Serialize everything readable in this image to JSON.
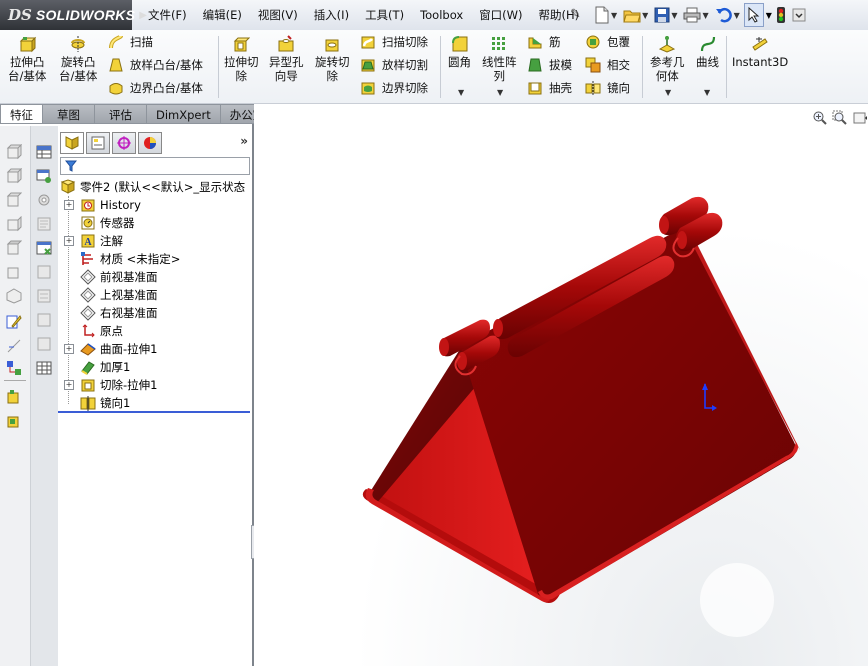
{
  "app": {
    "brand_symbol": "DS",
    "brand_name": "SOLIDWORKS",
    "brand_arrow": "▶"
  },
  "menu": [
    "文件(F)",
    "编辑(E)",
    "视图(V)",
    "插入(I)",
    "工具(T)",
    "Toolbox",
    "窗口(W)",
    "帮助(H)"
  ],
  "quick_tools": [
    "new-document-icon",
    "open-folder-icon",
    "save-icon",
    "print-icon",
    "undo-icon",
    "select-arrow-icon",
    "rebuild-traffic-light-icon"
  ],
  "command_manager": {
    "extrude_boss": "拉伸凸\n台/基体",
    "revolve_boss": "旋转凸\n台/基体",
    "sweep": "扫描",
    "loft_boss": "放样凸台/基体",
    "boundary_boss": "边界凸台/基体",
    "extrude_cut": "拉伸切\n除",
    "hole_wizard": "异型孔\n向导",
    "revolve_cut": "旋转切\n除",
    "swept_cut": "扫描切除",
    "lofted_cut": "放样切割",
    "boundary_cut": "边界切除",
    "fillet": "圆角",
    "linear_pattern": "线性阵\n列",
    "rib": "筋",
    "draft": "拔模",
    "shell": "抽壳",
    "wrap": "包覆",
    "intersect": "相交",
    "mirror": "镜向",
    "reference_geometry": "参考几\n何体",
    "curves": "曲线",
    "instant3d": "Instant3D"
  },
  "tabs": [
    "特征",
    "草图",
    "评估",
    "DimXpert",
    "办公室产品"
  ],
  "active_tab": 0,
  "feature_manager": {
    "root": "零件2 (默认<<默认>_显示状态",
    "items": [
      {
        "label": "History",
        "icon": "history-folder-icon",
        "expandable": true
      },
      {
        "label": "传感器",
        "icon": "sensor-icon",
        "expandable": false
      },
      {
        "label": "注解",
        "icon": "annotation-icon",
        "expandable": true
      },
      {
        "label": "材质 <未指定>",
        "icon": "material-icon",
        "expandable": false
      },
      {
        "label": "前视基准面",
        "icon": "plane-icon",
        "expandable": false
      },
      {
        "label": "上视基准面",
        "icon": "plane-icon",
        "expandable": false
      },
      {
        "label": "右视基准面",
        "icon": "plane-icon",
        "expandable": false
      },
      {
        "label": "原点",
        "icon": "origin-icon",
        "expandable": false
      },
      {
        "label": "曲面-拉伸1",
        "icon": "surface-extrude-icon",
        "expandable": true
      },
      {
        "label": "加厚1",
        "icon": "thicken-icon",
        "expandable": false
      },
      {
        "label": "切除-拉伸1",
        "icon": "cut-extrude-icon",
        "expandable": true
      },
      {
        "label": "镜向1",
        "icon": "mirror-feature-icon",
        "expandable": false
      }
    ]
  },
  "colors": {
    "model_face": "#7a0505",
    "model_highlight": "#c81818",
    "model_inner": "#e01a1a",
    "selection_line": "#3a5dd6"
  }
}
